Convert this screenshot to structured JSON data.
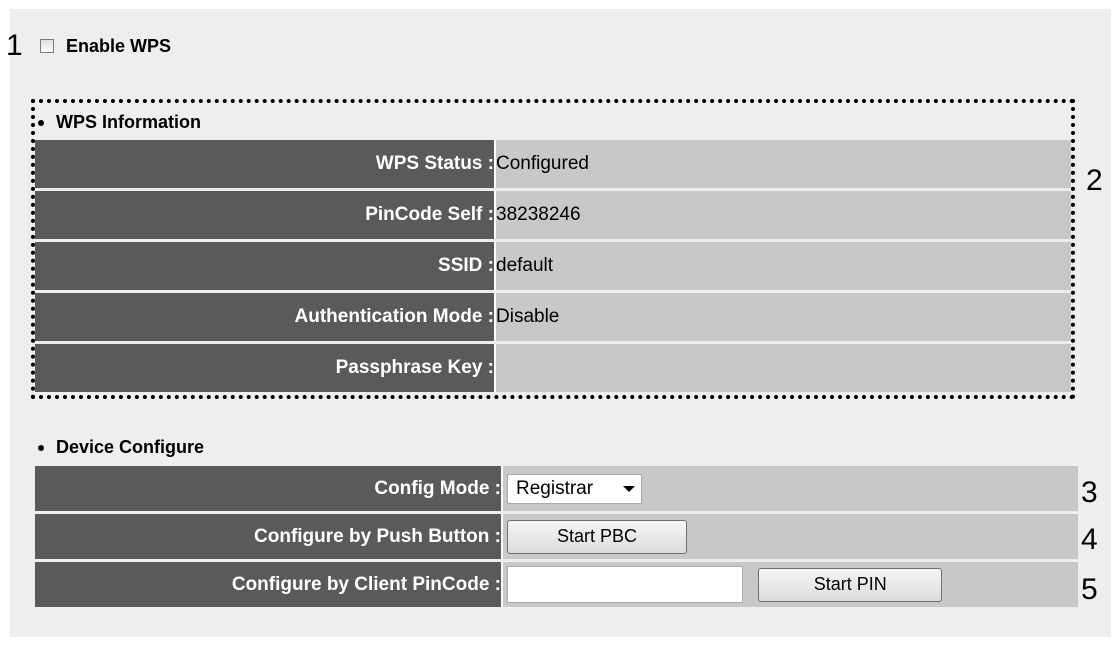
{
  "callouts": {
    "c1": "1",
    "c2": "2",
    "c3": "3",
    "c4": "4",
    "c5": "5"
  },
  "enable_wps": {
    "label": "Enable WPS",
    "checked": false
  },
  "wps_info": {
    "title": "WPS Information",
    "rows": [
      {
        "label": "WPS Status :",
        "value": "Configured"
      },
      {
        "label": "PinCode Self :",
        "value": "38238246"
      },
      {
        "label": "SSID :",
        "value": "default"
      },
      {
        "label": "Authentication Mode :",
        "value": "Disable"
      },
      {
        "label": "Passphrase Key :",
        "value": ""
      }
    ]
  },
  "device_configure": {
    "title": "Device Configure",
    "config_mode": {
      "label": "Config Mode :",
      "selected": "Registrar"
    },
    "push_button": {
      "label": "Configure by Push Button :",
      "button": "Start PBC"
    },
    "client_pincode": {
      "label": "Configure by Client PinCode :",
      "input_value": "",
      "button": "Start PIN"
    }
  },
  "colors": {
    "label_bg": "#5a5a5a",
    "value_bg": "#c8c8c8",
    "panel_bg": "#eeeeee"
  }
}
